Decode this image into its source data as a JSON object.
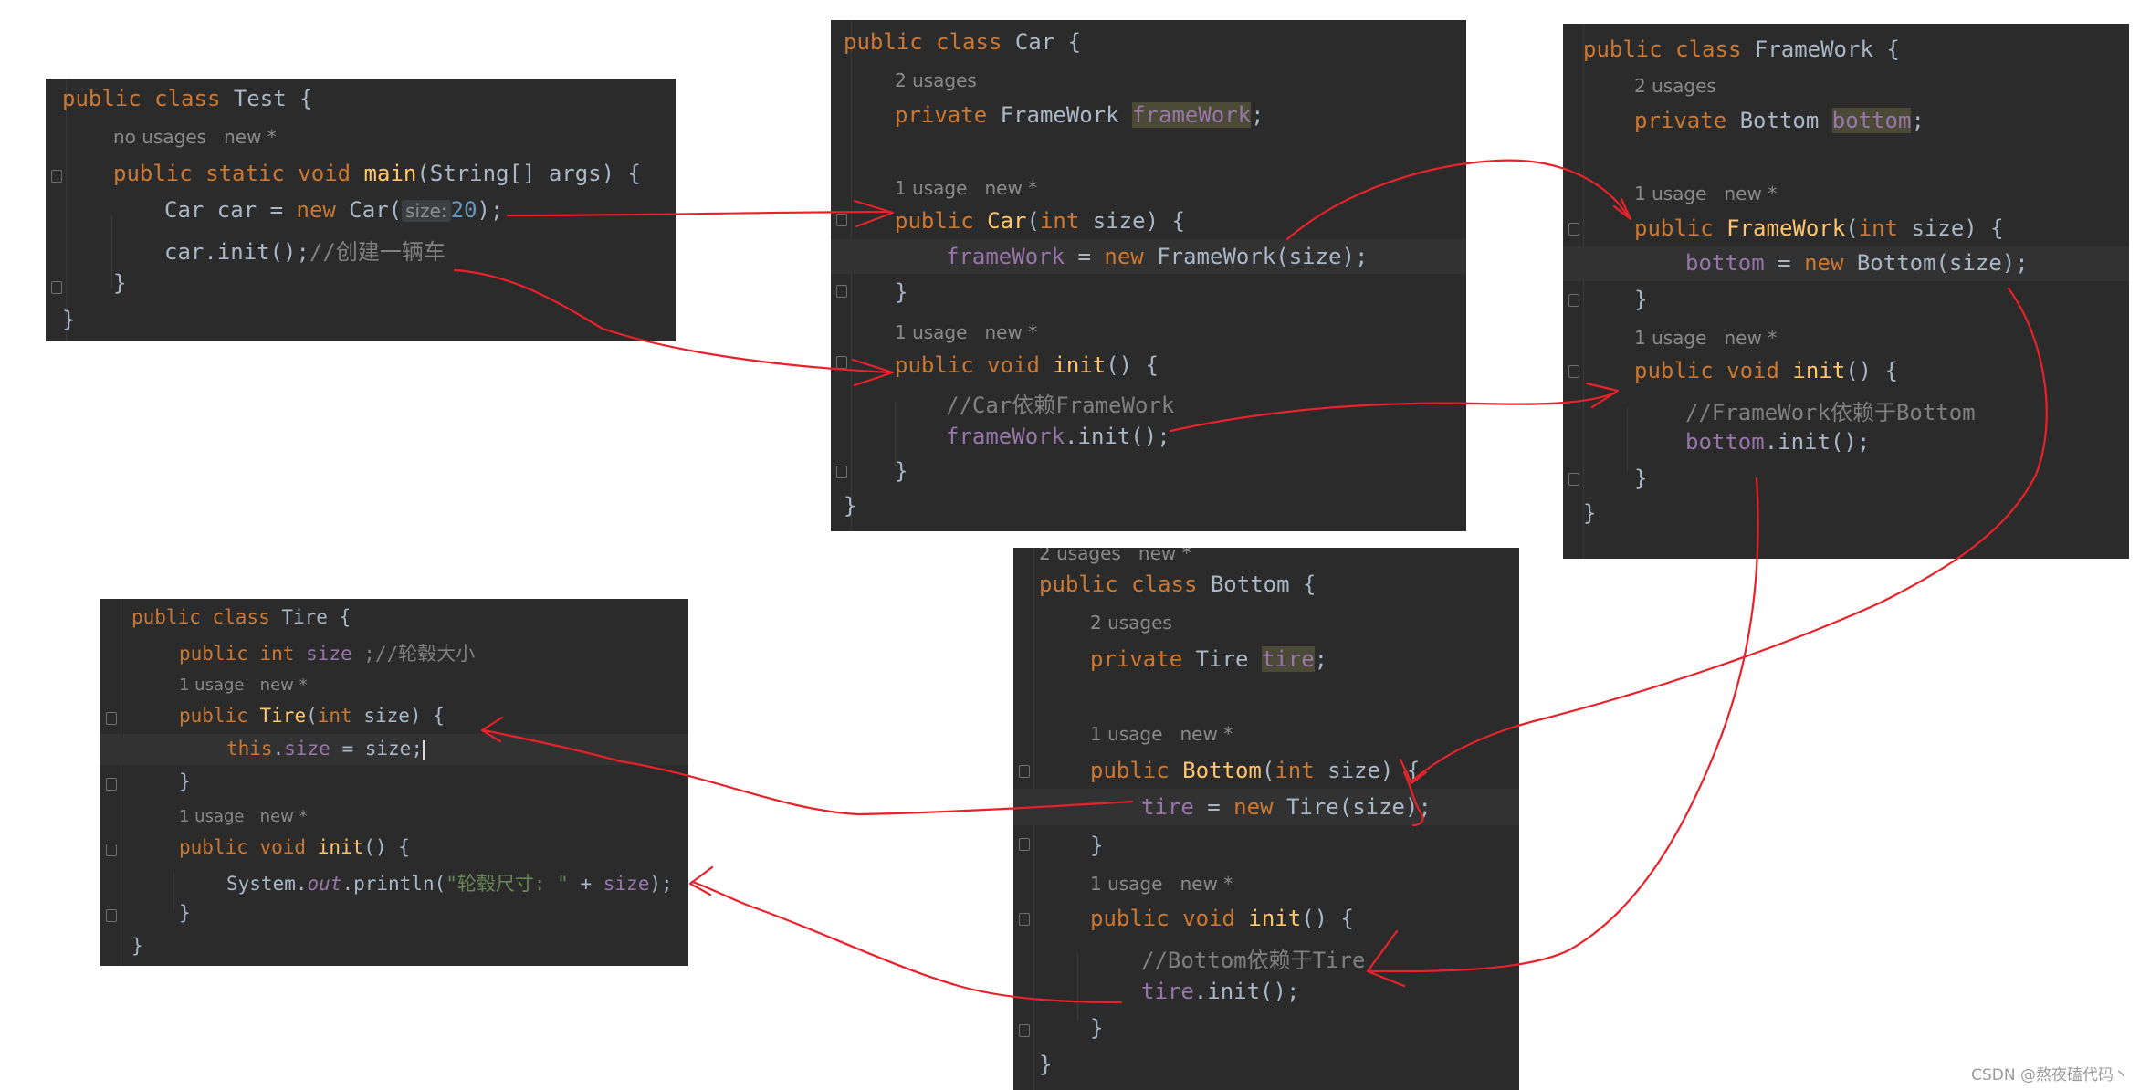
{
  "test": {
    "l1_kw": "public class ",
    "l1_name": "Test {",
    "l2": "no usages   new *",
    "l3_kw": "public static void ",
    "l3_fn": "main",
    "l3_rest": "(String[] args) {",
    "l4_a": "Car car = ",
    "l4_kw": "new ",
    "l4_b": "Car(",
    "l4_hint": "size:",
    "l4_num": "20",
    "l4_c": ");",
    "l5_a": "car.init();",
    "l5_cmt": "//创建一辆车",
    "l6": "}",
    "l7": "}"
  },
  "car": {
    "l1_kw": "public class ",
    "l1_name": "Car {",
    "l2": "2 usages",
    "l3_kw": "private ",
    "l3_type": "FrameWork ",
    "l3_fld": "frameWork",
    "l3_end": ";",
    "l4": "1 usage   new *",
    "l5_kw": "public ",
    "l5_fn": "Car",
    "l5_a": "(",
    "l5_kw2": "int",
    "l5_b": " size) {",
    "l6_fld": "frameWork",
    "l6_a": " = ",
    "l6_kw": "new ",
    "l6_b": "FrameWork(size);",
    "l7": "}",
    "l8": "1 usage   new *",
    "l9_kw": "public void ",
    "l9_fn": "init",
    "l9_rest": "() {",
    "l10_cmt": "//Car依赖FrameWork",
    "l11_fld": "frameWork",
    "l11_rest": ".init();",
    "l12": "}",
    "l13": "}"
  },
  "framework": {
    "l1_kw": "public class ",
    "l1_name": "FrameWork {",
    "l2": "2 usages",
    "l3_kw": "private ",
    "l3_type": "Bottom ",
    "l3_fld": "bottom",
    "l3_end": ";",
    "l4": "1 usage   new *",
    "l5_kw": "public ",
    "l5_fn": "FrameWork",
    "l5_a": "(",
    "l5_kw2": "int",
    "l5_b": " size) {",
    "l6_fld": "bottom",
    "l6_a": " = ",
    "l6_kw": "new ",
    "l6_b": "Bottom(size);",
    "l7": "}",
    "l8": "1 usage   new *",
    "l9_kw": "public void ",
    "l9_fn": "init",
    "l9_rest": "() {",
    "l10_cmt": "//FrameWork依赖于Bottom",
    "l11_fld": "bottom",
    "l11_rest": ".init();",
    "l12": "}",
    "l13": "}"
  },
  "bottom": {
    "l0": "2 usages   new *",
    "l1_kw": "public class ",
    "l1_name": "Bottom {",
    "l2": "2 usages",
    "l3_kw": "private ",
    "l3_type": "Tire ",
    "l3_fld": "tire",
    "l3_end": ";",
    "l4": "1 usage   new *",
    "l5_kw": "public ",
    "l5_fn": "Bottom",
    "l5_a": "(",
    "l5_kw2": "int",
    "l5_b": " size) {",
    "l6_fld": "tire",
    "l6_a": " = ",
    "l6_kw": "new ",
    "l6_b": "Tire(size);",
    "l7": "}",
    "l8": "1 usage   new *",
    "l9_kw": "public void ",
    "l9_fn": "init",
    "l9_rest": "() {",
    "l10_cmt": "//Bottom依赖于Tire",
    "l11_fld": "tire",
    "l11_rest": ".init();",
    "l12": "}",
    "l13": "}"
  },
  "tire": {
    "l1_kw": "public class ",
    "l1_name": "Tire {",
    "l2_kw": "public int ",
    "l2_fld": "size",
    "l2_cmt": " ;//轮毂大小",
    "l3": "1 usage   new *",
    "l4_kw": "public ",
    "l4_fn": "Tire",
    "l4_a": "(",
    "l4_kw2": "int",
    "l4_b": " size) {",
    "l5_kw": "this",
    "l5_a": ".",
    "l5_fld": "size",
    "l5_b": " = size;",
    "l6": "}",
    "l7": "1 usage   new *",
    "l8_kw": "public void ",
    "l8_fn": "init",
    "l8_rest": "() {",
    "l9_a": "System.",
    "l9_out": "out",
    "l9_b": ".println(",
    "l9_str": "\"轮毂尺寸: \"",
    "l9_c": " + ",
    "l9_fld": "size",
    "l9_d": ");",
    "l10": "}",
    "l11": "}"
  },
  "arrow_color": "#e8212a",
  "watermark": "CSDN @熬夜磕代码丶"
}
